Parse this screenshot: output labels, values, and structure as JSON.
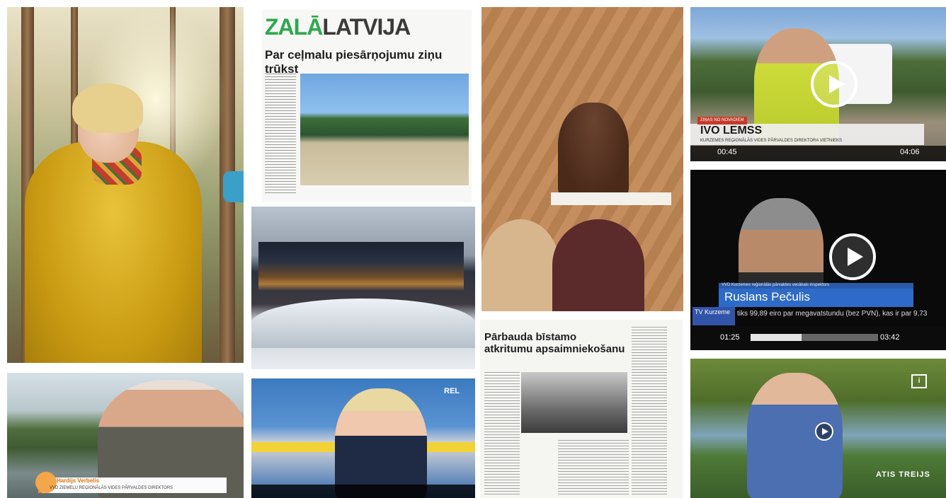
{
  "newspaper_front": {
    "masthead_part1": "ZALĀ",
    "masthead_part2": "LATVIJA",
    "headline": "Par ceļmalu piesārņojumu ziņu trūkst"
  },
  "article_clipping": {
    "headline": "Pārbauda bīstamo atkritumu apsaimniekošanu"
  },
  "video_ivo": {
    "tag": "ZIŅAS NO NOVADIEM",
    "name": "IVO LEMSS",
    "subtitle": "KURZEMES REĢIONĀLĀS VIDES PĀRVALDES DIREKTORA VIETNIEKS",
    "time_current": "00:45",
    "time_total": "04:06"
  },
  "video_ruslans": {
    "subtitle": "VVD Kurzemes reģionālās pārvaldes vecākais inspektors",
    "name": "Ruslans Pečulis",
    "channel_logo": "TV Kurzeme",
    "ticker": "tiks 99,89 eiro par megavatstundu (bez PVN), kas ir par 9,73",
    "time_current": "01:25",
    "time_total": "03:42",
    "progress_fraction": 0.4
  },
  "video_hardijs": {
    "name": "Hardijs Verbelis",
    "subtitle": "VVD ZIEMEĻU REĢIONĀLĀS VIDES PĀRVALDES DIREKTORS"
  },
  "video_rel": {
    "channel": "REL"
  },
  "video_atis": {
    "name": "ATIS TREIJS",
    "badge": "i"
  }
}
